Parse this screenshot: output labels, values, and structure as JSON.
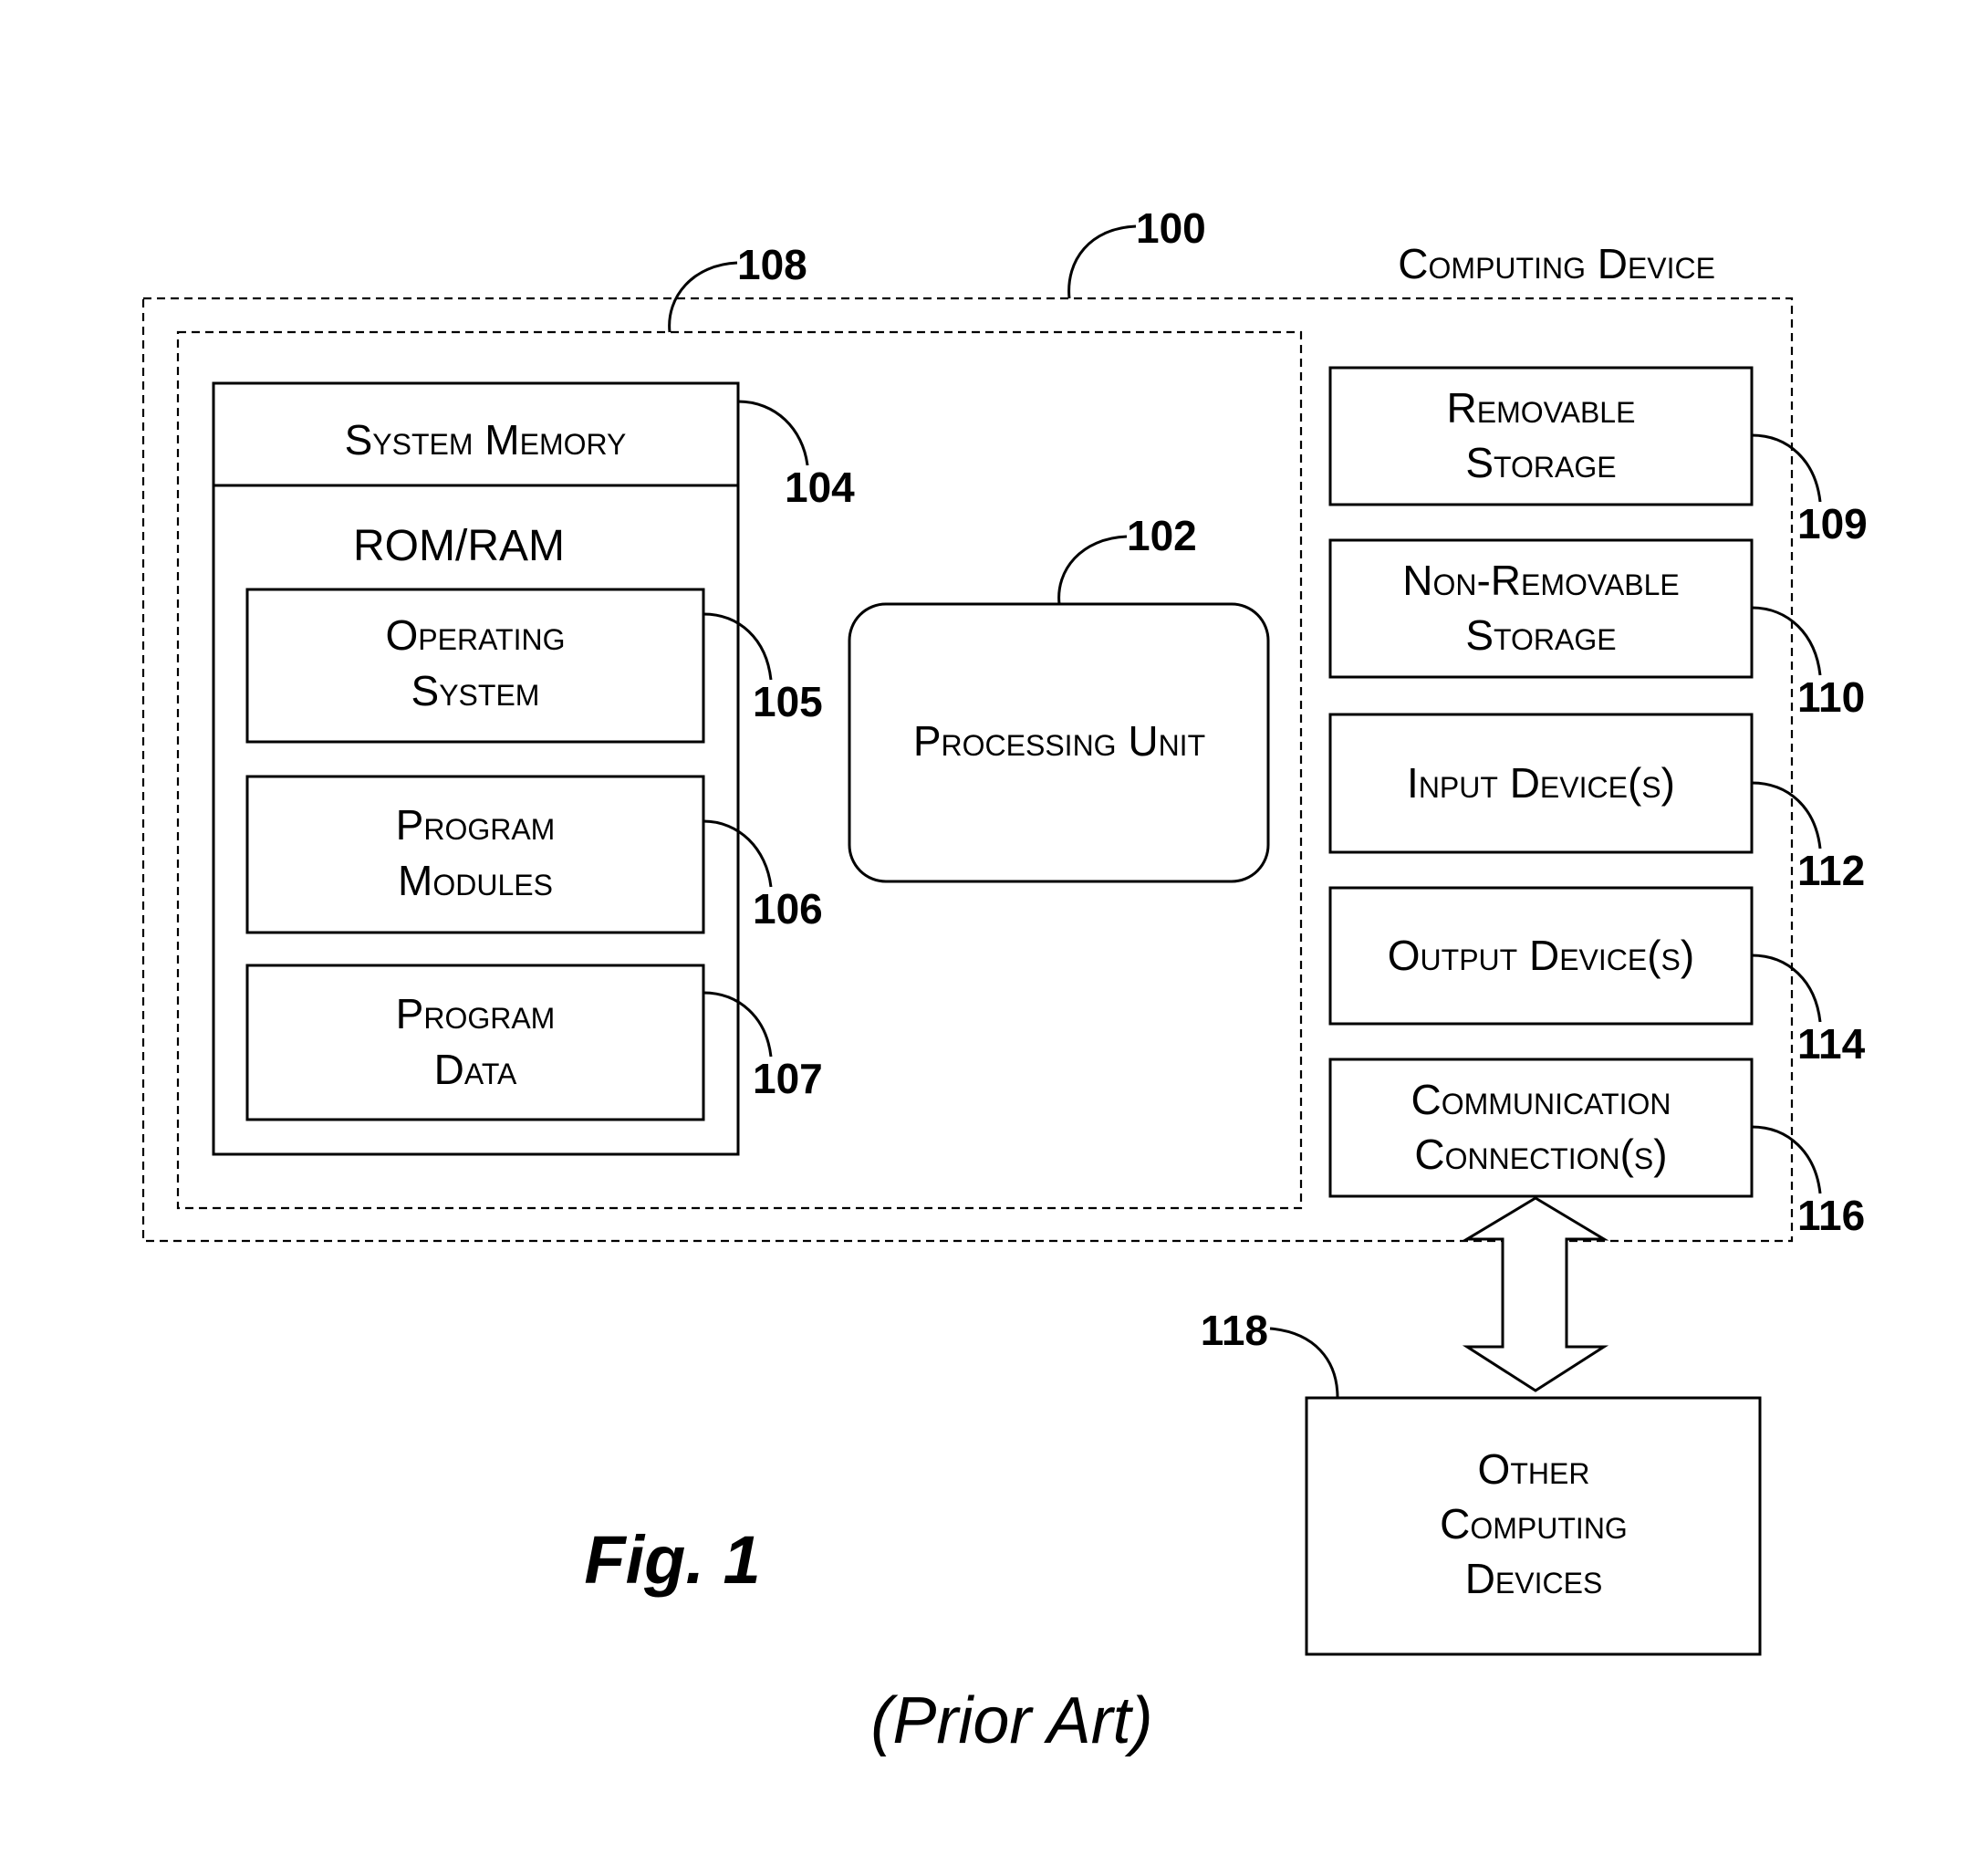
{
  "figure": {
    "title": "Fig. 1",
    "subtitle": "(Prior Art)"
  },
  "computing_device": {
    "label": "Computing Device",
    "ref": "100"
  },
  "core_group": {
    "ref": "108"
  },
  "system_memory": {
    "label": "System Memory",
    "ref": "104",
    "sublabel": "ROM/RAM",
    "items": [
      {
        "lines": [
          "Operating",
          "System"
        ],
        "ref": "105"
      },
      {
        "lines": [
          "Program",
          "Modules"
        ],
        "ref": "106"
      },
      {
        "lines": [
          "Program",
          "Data"
        ],
        "ref": "107"
      }
    ]
  },
  "processing_unit": {
    "label": "Processing Unit",
    "ref": "102"
  },
  "peripherals": [
    {
      "lines": [
        "Removable",
        "Storage"
      ],
      "ref": "109"
    },
    {
      "lines": [
        "Non-Removable",
        "Storage"
      ],
      "ref": "110"
    },
    {
      "lines": [
        "Input Device(s)"
      ],
      "ref": "112"
    },
    {
      "lines": [
        "Output Device(s)"
      ],
      "ref": "114"
    },
    {
      "lines": [
        "Communication",
        "Connection(s)"
      ],
      "ref": "116"
    }
  ],
  "other_devices": {
    "lines": [
      "Other",
      "Computing",
      "Devices"
    ],
    "ref": "118"
  }
}
